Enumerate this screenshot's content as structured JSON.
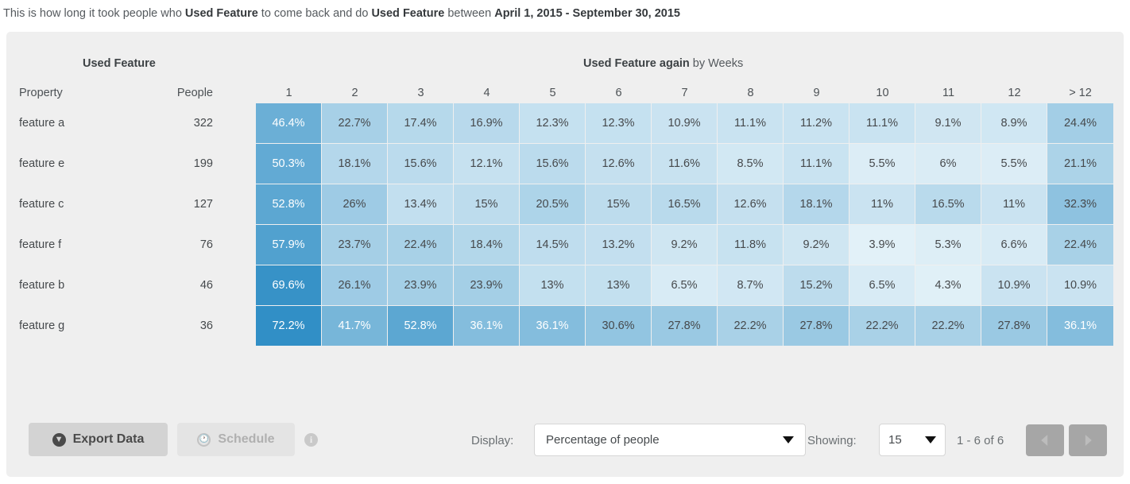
{
  "caption": {
    "part1": "This is how long it took people who ",
    "bold1": "Used Feature",
    "part2": " to come back and do ",
    "bold2": "Used Feature",
    "part3": " between ",
    "bold3": "April 1, 2015 - September 30, 2015"
  },
  "table": {
    "group_left": "Used Feature",
    "group_right_bold": "Used Feature again",
    "group_right_light": " by Weeks",
    "col_property": "Property",
    "col_people": "People",
    "week_headers": [
      "1",
      "2",
      "3",
      "4",
      "5",
      "6",
      "7",
      "8",
      "9",
      "10",
      "11",
      "12",
      "> 12"
    ]
  },
  "chart_data": {
    "type": "heatmap",
    "title": "This is how long it took people who Used Feature to come back and do Used Feature between April 1, 2015 - September 30, 2015",
    "xlabel": "Used Feature again by Weeks",
    "ylabel": "Used Feature",
    "columns": [
      "1",
      "2",
      "3",
      "4",
      "5",
      "6",
      "7",
      "8",
      "9",
      "10",
      "11",
      "12",
      "> 12"
    ],
    "rows": [
      "feature a",
      "feature e",
      "feature c",
      "feature f",
      "feature b",
      "feature g"
    ],
    "people": [
      322,
      199,
      127,
      76,
      46,
      36
    ],
    "unit": "percent",
    "values": [
      [
        46.4,
        22.7,
        17.4,
        16.9,
        12.3,
        12.3,
        10.9,
        11.1,
        11.2,
        11.1,
        9.1,
        8.9,
        24.4
      ],
      [
        50.3,
        18.1,
        15.6,
        12.1,
        15.6,
        12.6,
        11.6,
        8.5,
        11.1,
        5.5,
        6,
        5.5,
        21.1
      ],
      [
        52.8,
        26,
        13.4,
        15,
        20.5,
        15,
        16.5,
        12.6,
        18.1,
        11,
        16.5,
        11,
        32.3
      ],
      [
        57.9,
        23.7,
        22.4,
        18.4,
        14.5,
        13.2,
        9.2,
        11.8,
        9.2,
        3.9,
        5.3,
        6.6,
        22.4
      ],
      [
        69.6,
        26.1,
        23.9,
        23.9,
        13,
        13,
        6.5,
        8.7,
        15.2,
        6.5,
        4.3,
        10.9,
        10.9
      ],
      [
        72.2,
        41.7,
        52.8,
        36.1,
        36.1,
        30.6,
        27.8,
        22.2,
        27.8,
        22.2,
        22.2,
        27.8,
        36.1
      ]
    ],
    "labels": [
      [
        "46.4%",
        "22.7%",
        "17.4%",
        "16.9%",
        "12.3%",
        "12.3%",
        "10.9%",
        "11.1%",
        "11.2%",
        "11.1%",
        "9.1%",
        "8.9%",
        "24.4%"
      ],
      [
        "50.3%",
        "18.1%",
        "15.6%",
        "12.1%",
        "15.6%",
        "12.6%",
        "11.6%",
        "8.5%",
        "11.1%",
        "5.5%",
        "6%",
        "5.5%",
        "21.1%"
      ],
      [
        "52.8%",
        "26%",
        "13.4%",
        "15%",
        "20.5%",
        "15%",
        "16.5%",
        "12.6%",
        "18.1%",
        "11%",
        "16.5%",
        "11%",
        "32.3%"
      ],
      [
        "57.9%",
        "23.7%",
        "22.4%",
        "18.4%",
        "14.5%",
        "13.2%",
        "9.2%",
        "11.8%",
        "9.2%",
        "3.9%",
        "5.3%",
        "6.6%",
        "22.4%"
      ],
      [
        "69.6%",
        "26.1%",
        "23.9%",
        "23.9%",
        "13%",
        "13%",
        "6.5%",
        "8.7%",
        "15.2%",
        "6.5%",
        "4.3%",
        "10.9%",
        "10.9%"
      ],
      [
        "72.2%",
        "41.7%",
        "52.8%",
        "36.1%",
        "36.1%",
        "30.6%",
        "27.8%",
        "22.2%",
        "27.8%",
        "22.2%",
        "22.2%",
        "27.8%",
        "36.1%"
      ]
    ],
    "colorscale": {
      "min_color": "#f5fbfd",
      "max_color": "#2b8cc4",
      "min_value": 0,
      "max_value": 75
    }
  },
  "footer": {
    "export_label": "Export Data",
    "export_icon": "download-circle-icon",
    "schedule_label": "Schedule",
    "schedule_icon": "clock-icon",
    "info_icon": "info-icon",
    "info_glyph": "i",
    "display_label": "Display:",
    "display_value": "Percentage of people",
    "showing_label": "Showing:",
    "rows_value": "15",
    "range_text": "1 - 6 of 6",
    "prev_icon": "chevron-left-icon",
    "next_icon": "chevron-right-icon"
  },
  "colors": {
    "panel_bg": "#efefef",
    "accent_blue": "#2b8cc4",
    "text_dark": "#45494c",
    "text_muted": "#6b7073"
  }
}
